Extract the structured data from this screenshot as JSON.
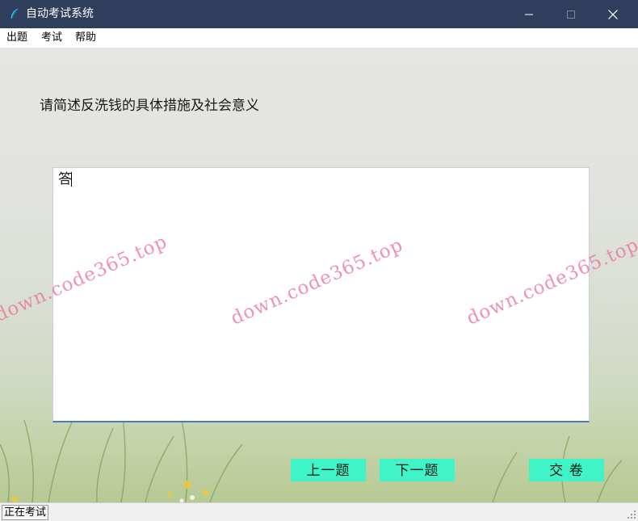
{
  "window": {
    "title": "自动考试系统",
    "icon": "feather-icon",
    "controls": [
      "minimize-icon",
      "maximize-icon",
      "close-icon"
    ]
  },
  "menu": {
    "items": [
      "出题",
      "考试",
      "帮助"
    ]
  },
  "exam": {
    "question": "请简述反洗钱的具体措施及社会意义",
    "answer_value": "答"
  },
  "buttons": {
    "prev": "上一题",
    "next": "下一题",
    "submit": "交 卷"
  },
  "status": {
    "text": "正在考试"
  },
  "watermark": {
    "text": "down.code365.top"
  },
  "colors": {
    "titlebar": "#2f3e5c",
    "button": "#3ff4c6",
    "watermark": "#ec6e96"
  }
}
